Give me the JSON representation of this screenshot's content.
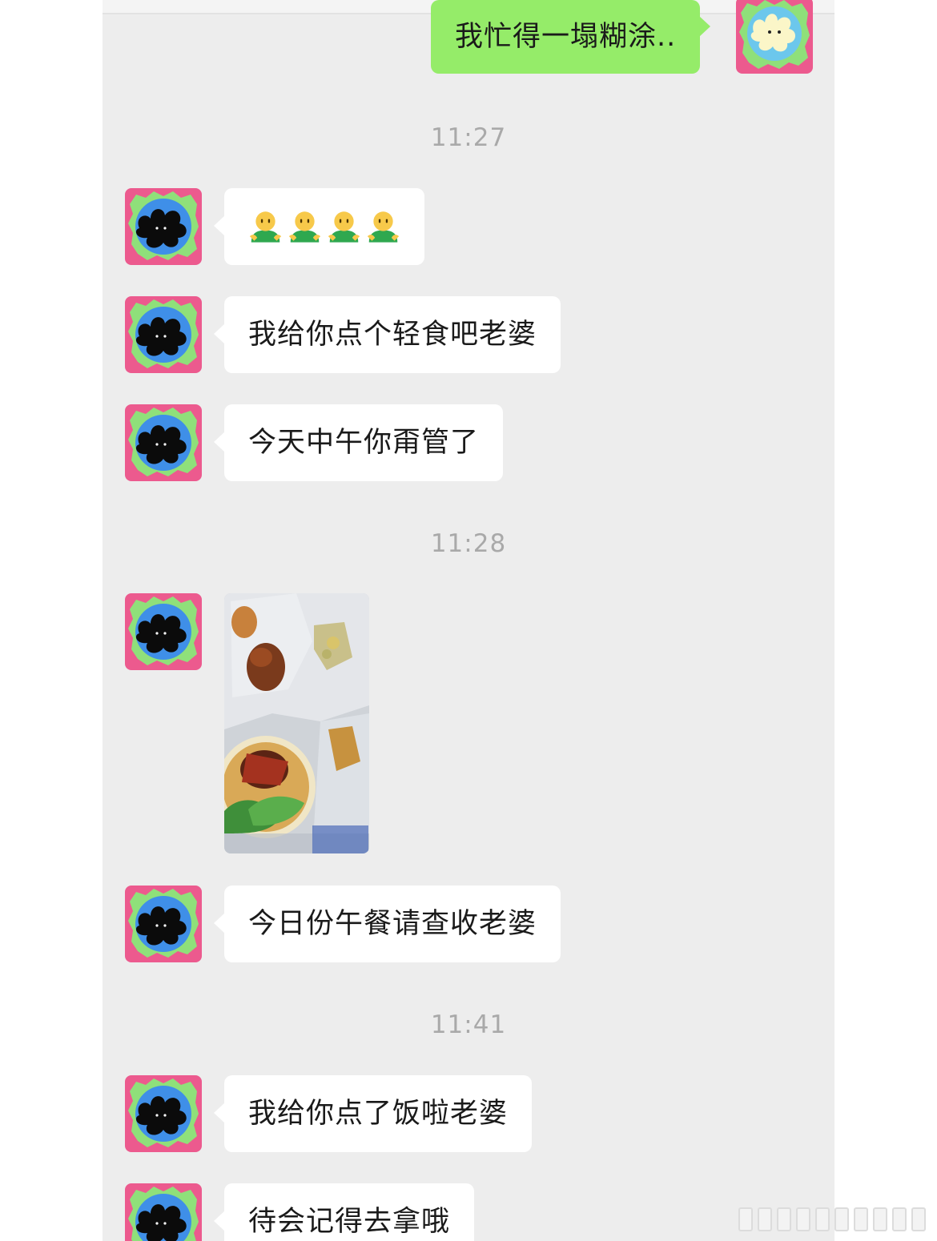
{
  "messages": {
    "m1": "我忙得一塌糊涂..",
    "t1": "11:27",
    "m3": "我给你点个轻食吧老婆",
    "m4": "今天中午你甭管了",
    "t2": "11:28",
    "m6": "今日份午餐请查收老婆",
    "t3": "11:41",
    "m7": "我给你点了饭啦老婆",
    "m8": "待会记得去拿哦"
  },
  "emojis": [
    "person-shrug-emoji",
    "person-shrug-emoji",
    "person-shrug-emoji",
    "person-shrug-emoji"
  ],
  "colors": {
    "background": "#ededed",
    "sent_bubble": "#95ec69",
    "received_bubble": "#ffffff",
    "timestamp": "#a9a9a9"
  }
}
